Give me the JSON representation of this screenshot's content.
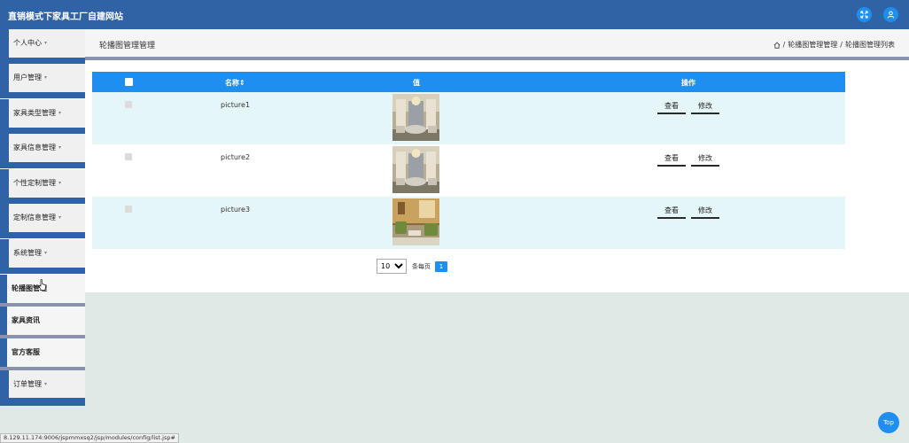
{
  "header": {
    "title": "直销模式下家具工厂自建网站",
    "fullscreen_icon": "fullscreen-icon",
    "user_icon": "user-icon"
  },
  "sidebar": {
    "items": [
      {
        "label": "个人中心",
        "has_caret": true
      },
      {
        "label": "用户管理",
        "has_caret": true
      },
      {
        "label": "家具类型管理",
        "has_caret": true
      },
      {
        "label": "家具信息管理",
        "has_caret": true
      },
      {
        "label": "个性定制管理",
        "has_caret": true
      },
      {
        "label": "定制信息管理",
        "has_caret": true
      },
      {
        "label": "系统管理",
        "has_caret": true
      },
      {
        "label": "轮播图管理",
        "has_caret": false
      },
      {
        "label": "家具资讯",
        "has_caret": false
      },
      {
        "label": "官方客服",
        "has_caret": false
      },
      {
        "label": "订单管理",
        "has_caret": true
      }
    ],
    "caret_glyph": "▾"
  },
  "page": {
    "title": "轮播图管理管理",
    "breadcrumb": [
      "轮播图管理管理",
      "轮播图管理列表"
    ],
    "breadcrumb_sep": "/"
  },
  "table": {
    "columns": {
      "name": "名称",
      "sort_glyph": "⇕",
      "value": "值",
      "actions": "操作"
    },
    "rows": [
      {
        "name": "picture1",
        "view": "查看",
        "edit": "修改"
      },
      {
        "name": "picture2",
        "view": "查看",
        "edit": "修改"
      },
      {
        "name": "picture3",
        "view": "查看",
        "edit": "修改"
      }
    ]
  },
  "pagination": {
    "page_size": "10",
    "page_size_options": [
      "10"
    ],
    "per_page_label": "条每页",
    "current_page": "1"
  },
  "status_url": "8.129.11.174:9006/jspmmxsq2/jsp/modules/config/list.jsp#",
  "top_button": "Top",
  "colors": {
    "header": "#3062a6",
    "accent": "#1e8ef0",
    "row_alt": "#e5f6f8",
    "divider": "#8a93ad"
  }
}
